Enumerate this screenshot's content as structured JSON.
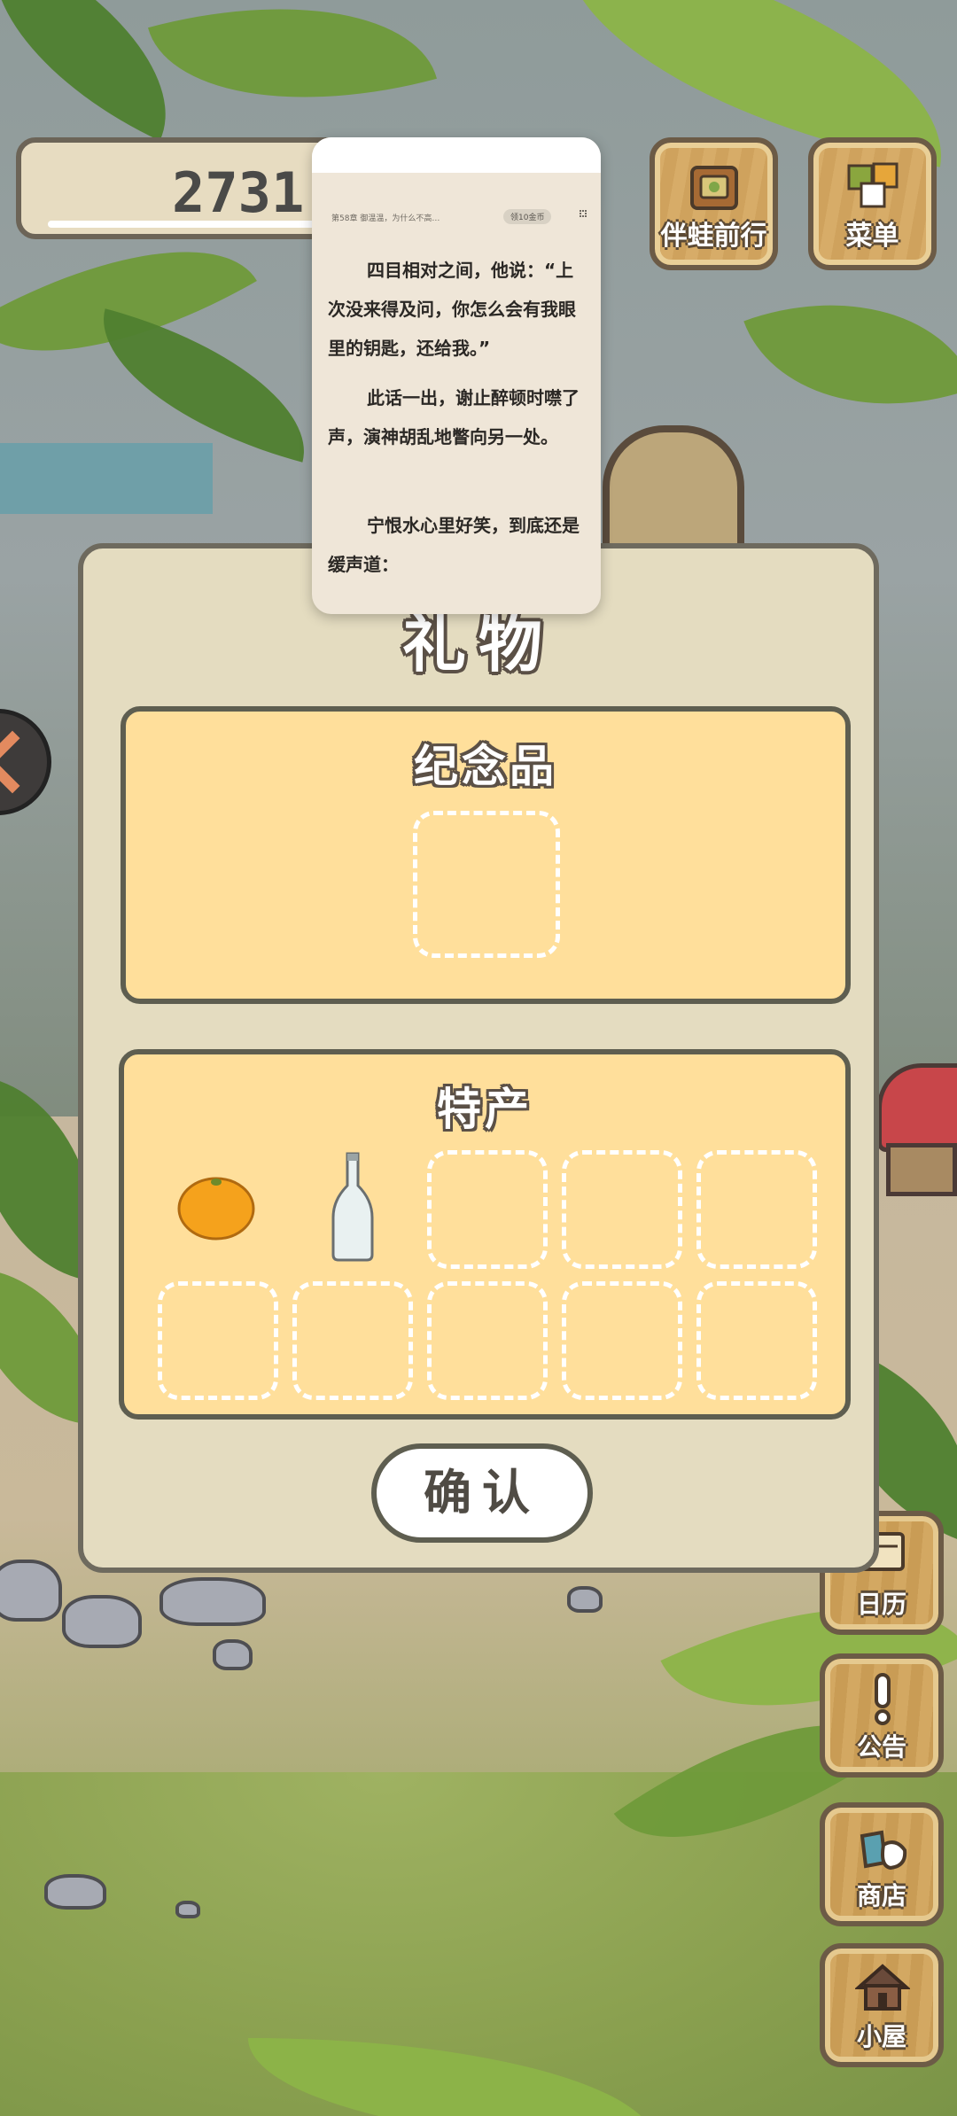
{
  "coins": {
    "value": "2731"
  },
  "top_buttons": {
    "companion_label": "伴蛙前行",
    "menu_label": "菜单"
  },
  "side_buttons": {
    "calendar_label": "日历",
    "notice_label": "公告",
    "shop_label": "商店",
    "house_label": "小屋"
  },
  "gift_dialog": {
    "title": "礼物",
    "souvenir": {
      "title": "纪念品"
    },
    "specialty": {
      "title": "特产",
      "items": [
        "orange-icon",
        "bottle-icon"
      ]
    },
    "confirm_label": "确认"
  },
  "reader": {
    "chapter": "第58章 御温温，为什么不高…",
    "badge": "领10金币",
    "paragraphs": [
      "四目相对之间，他说：“上次没来得及问，你怎么会有我眼里的钥匙，还给我。”",
      "此话一出，谢止醉顿时噤了声，演神胡乱地瞥向另一处。",
      "宁恨水心里好笑，到底还是缓声道："
    ]
  },
  "colors": {
    "dialog_bg": "#e4dcc0",
    "panel_bg": "#ffdf9b",
    "wood": "#d7ac68",
    "outline": "#5e5e50"
  }
}
